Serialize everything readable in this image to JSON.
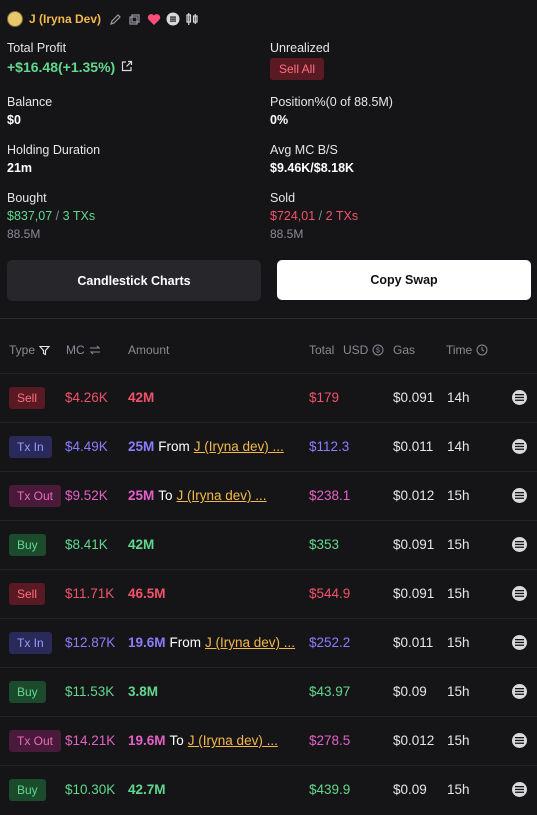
{
  "header": {
    "username": "J (Iryna Dev)"
  },
  "stats": {
    "total_profit_label": "Total Profit",
    "total_profit_value": "+$16.48(+1.35%)",
    "unrealized_label": "Unrealized",
    "sell_all_label": "Sell All",
    "balance_label": "Balance",
    "balance_value": "$0",
    "position_label": "Position%(0 of 88.5M)",
    "position_value": "0%",
    "holding_label": "Holding Duration",
    "holding_value": "21m",
    "avg_mc_label": "Avg MC B/S",
    "avg_mc_value": "$9.46K/$8.18K",
    "bought_label": "Bought",
    "bought_value": "$837,07",
    "bought_sep": "/",
    "bought_txs": "3 TXs",
    "bought_amount": "88.5M",
    "sold_label": "Sold",
    "sold_value": "$724,01",
    "sold_sep": "/",
    "sold_txs": "2 TXs",
    "sold_amount": "88.5M"
  },
  "buttons": {
    "candlestick": "Candlestick Charts",
    "copy_swap": "Copy Swap"
  },
  "table": {
    "headers": {
      "type": "Type",
      "mc": "MC",
      "amount": "Amount",
      "total": "Total",
      "usd": "USD",
      "gas": "Gas",
      "time": "Time"
    },
    "rows": [
      {
        "type": "Sell",
        "mc": "$4.26K",
        "amount": "42M",
        "dir": "",
        "addr": "",
        "total": "$179",
        "gas": "$0.091",
        "time": "14h"
      },
      {
        "type": "Tx In",
        "mc": "$4.49K",
        "amount": "25M",
        "dir": "From",
        "addr": "J (Iryna dev) ...",
        "total": "$112.3",
        "gas": "$0.011",
        "time": "14h"
      },
      {
        "type": "Tx Out",
        "mc": "$9.52K",
        "amount": "25M",
        "dir": "To",
        "addr": "J (Iryna dev) ...",
        "total": "$238.1",
        "gas": "$0.012",
        "time": "15h"
      },
      {
        "type": "Buy",
        "mc": "$8.41K",
        "amount": "42M",
        "dir": "",
        "addr": "",
        "total": "$353",
        "gas": "$0.091",
        "time": "15h"
      },
      {
        "type": "Sell",
        "mc": "$11.71K",
        "amount": "46.5M",
        "dir": "",
        "addr": "",
        "total": "$544.9",
        "gas": "$0.091",
        "time": "15h"
      },
      {
        "type": "Tx In",
        "mc": "$12.87K",
        "amount": "19.6M",
        "dir": "From",
        "addr": "J (Iryna dev) ...",
        "total": "$252.2",
        "gas": "$0.011",
        "time": "15h"
      },
      {
        "type": "Buy",
        "mc": "$11.53K",
        "amount": "3.8M",
        "dir": "",
        "addr": "",
        "total": "$43.97",
        "gas": "$0.09",
        "time": "15h"
      },
      {
        "type": "Tx Out",
        "mc": "$14.21K",
        "amount": "19.6M",
        "dir": "To",
        "addr": "J (Iryna dev) ...",
        "total": "$278.5",
        "gas": "$0.012",
        "time": "15h"
      },
      {
        "type": "Buy",
        "mc": "$10.30K",
        "amount": "42.7M",
        "dir": "",
        "addr": "",
        "total": "$439.9",
        "gas": "$0.09",
        "time": "15h"
      }
    ]
  },
  "colors": {
    "accent": "#f3b94a",
    "green": "#61d88e",
    "red": "#f2526a",
    "blue": "#8c7dff",
    "pink": "#e560c6",
    "bg": "#151518"
  },
  "icons": [
    "avatar",
    "edit-icon",
    "copy-icon",
    "heart-icon",
    "menu-circle-icon",
    "candles-icon",
    "external-link-icon",
    "filter-icon",
    "swap-arrows-icon",
    "usd-toggle-icon",
    "clock-icon",
    "row-menu-icon"
  ]
}
